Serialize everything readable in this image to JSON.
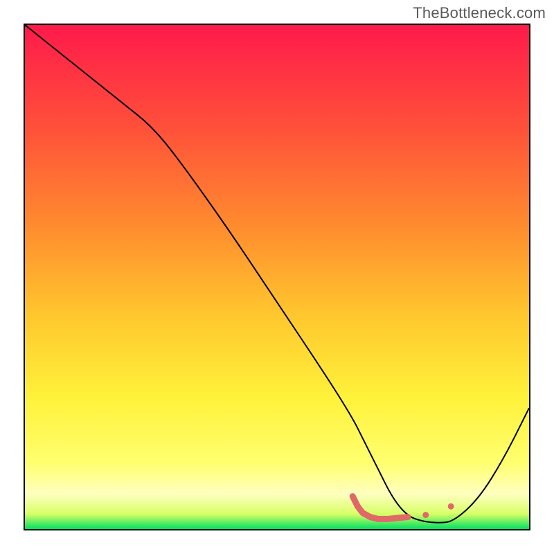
{
  "watermark_text": "TheBottleneck.com",
  "chart_data": {
    "type": "line",
    "title": "",
    "xlabel": "",
    "ylabel": "",
    "xlim": [
      0,
      100
    ],
    "ylim": [
      0,
      100
    ],
    "grid": false,
    "legend": false,
    "gradient_stops": [
      {
        "offset": 0.0,
        "color": "#ff1a4b"
      },
      {
        "offset": 0.2,
        "color": "#ff4f3a"
      },
      {
        "offset": 0.4,
        "color": "#ff8c2e"
      },
      {
        "offset": 0.58,
        "color": "#ffc82e"
      },
      {
        "offset": 0.74,
        "color": "#fff23a"
      },
      {
        "offset": 0.87,
        "color": "#ffff70"
      },
      {
        "offset": 0.93,
        "color": "#ffffc0"
      },
      {
        "offset": 0.97,
        "color": "#d8ff66"
      },
      {
        "offset": 1.0,
        "color": "#00e060"
      }
    ],
    "series": [
      {
        "name": "bottleneck-curve",
        "color": "#000000",
        "width": 2,
        "x": [
          0,
          10,
          20,
          25,
          30,
          40,
          50,
          60,
          65,
          67,
          70,
          73,
          76,
          79,
          82,
          85,
          90,
          95,
          100
        ],
        "y": [
          100,
          92,
          84,
          80,
          74,
          60,
          45,
          30,
          22,
          18,
          12,
          6,
          2.5,
          1.5,
          1.2,
          1.5,
          6,
          14,
          24
        ]
      },
      {
        "name": "marker-segment",
        "type": "overlay",
        "color": "#e06868",
        "width": 9,
        "linecap": "round",
        "x": [
          65,
          66,
          67,
          68.5,
          70,
          72,
          74,
          76
        ],
        "y": [
          6.5,
          4.5,
          3.2,
          2.4,
          2.0,
          2.0,
          2.2,
          2.4
        ]
      },
      {
        "name": "marker-dot-1",
        "type": "point",
        "color": "#e06868",
        "x": 79.5,
        "y": 2.8,
        "r": 4.5
      },
      {
        "name": "marker-dot-2",
        "type": "point",
        "color": "#e06868",
        "x": 84.5,
        "y": 4.5,
        "r": 4.5
      }
    ]
  }
}
